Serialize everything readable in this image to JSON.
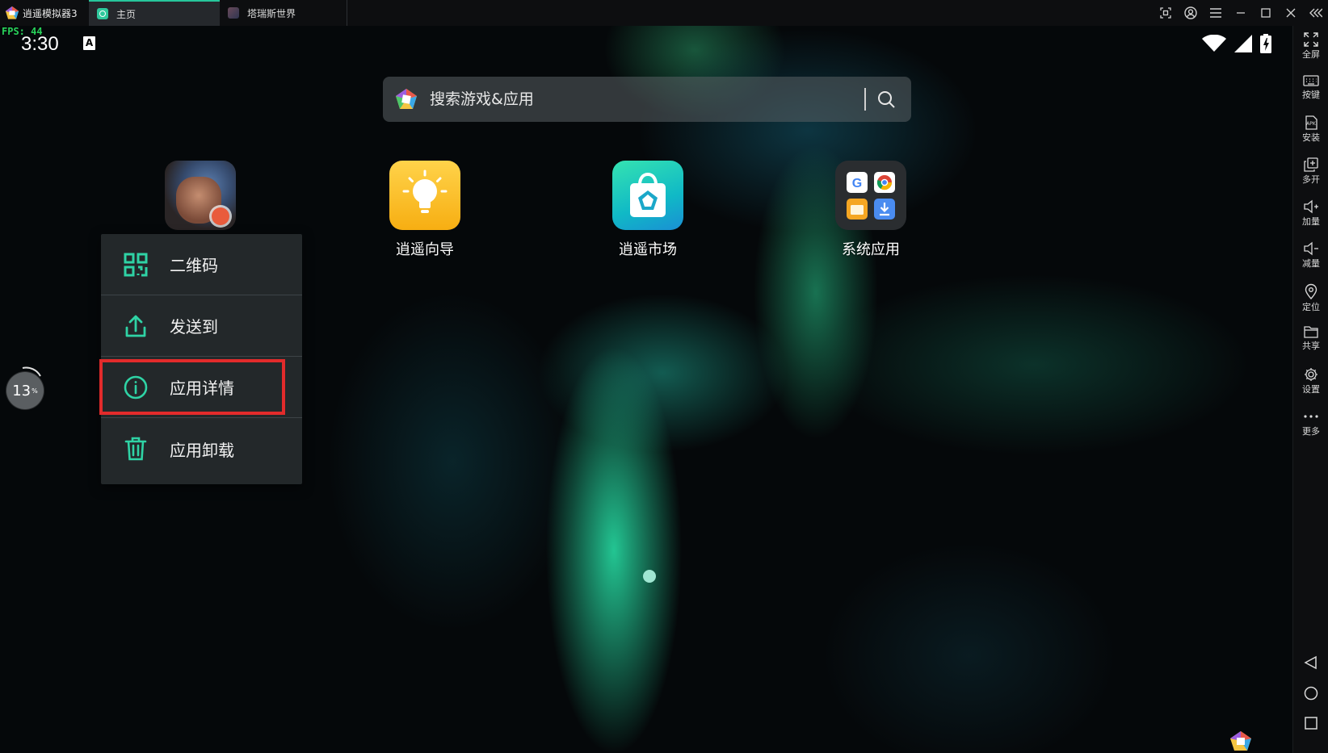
{
  "window": {
    "app_title": "逍遥模拟器3",
    "tabs": [
      {
        "label": "主页",
        "active": true
      },
      {
        "label": "塔瑞斯世界",
        "active": false
      }
    ],
    "controls": [
      "screenshot-icon",
      "account-icon",
      "menu-icon",
      "minimize-icon",
      "maximize-icon",
      "close-icon",
      "collapse-icon"
    ]
  },
  "status_bar": {
    "fps": "FPS: 44",
    "time": "3:30",
    "keyboard_indicator": "A"
  },
  "search": {
    "placeholder": "搜索游戏&应用"
  },
  "desktop_apps": [
    {
      "label": "",
      "icon": "game-icon"
    },
    {
      "label": "逍遥向导",
      "icon": "lightbulb-icon"
    },
    {
      "label": "逍遥市场",
      "icon": "shopping-bag-icon"
    },
    {
      "label": "系统应用",
      "icon": "app-folder-icon"
    }
  ],
  "context_menu": {
    "items": [
      {
        "label": "二维码",
        "icon": "qr-code-icon"
      },
      {
        "label": "发送到",
        "icon": "share-icon"
      },
      {
        "label": "应用详情",
        "icon": "info-icon",
        "highlighted": true
      },
      {
        "label": "应用卸载",
        "icon": "trash-icon"
      }
    ]
  },
  "float_ball": {
    "value": "13",
    "unit": "%"
  },
  "toolbar": {
    "items": [
      {
        "label": "全屏",
        "icon": "fullscreen-icon"
      },
      {
        "label": "按键",
        "icon": "keyboard-icon"
      },
      {
        "label": "安装",
        "icon": "apk-install-icon"
      },
      {
        "label": "多开",
        "icon": "multi-instance-icon"
      },
      {
        "label": "加量",
        "icon": "volume-up-icon"
      },
      {
        "label": "减量",
        "icon": "volume-down-icon"
      },
      {
        "label": "定位",
        "icon": "location-icon"
      },
      {
        "label": "共享",
        "icon": "folder-icon"
      },
      {
        "label": "设置",
        "icon": "settings-icon"
      },
      {
        "label": "更多",
        "icon": "more-icon"
      }
    ],
    "nav": [
      "back-icon",
      "home-icon",
      "recents-icon"
    ]
  },
  "colors": {
    "accent": "#2fd3a5",
    "highlight_border": "#e22b2b",
    "fps_text": "#28d35a"
  }
}
